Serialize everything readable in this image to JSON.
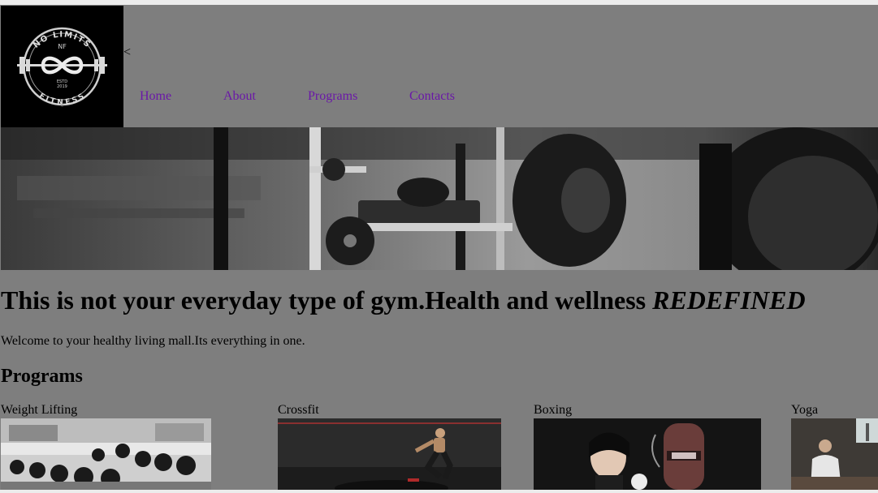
{
  "brand": {
    "logo_text_top": "NO LIMITS",
    "logo_text_bottom": "FITNESS",
    "logo_monogram": "NF",
    "logo_estd": "ESTD",
    "logo_year": "2019"
  },
  "header": {
    "broken_glyph": "<"
  },
  "nav": {
    "items": [
      {
        "label": "Home"
      },
      {
        "label": "About"
      },
      {
        "label": "Programs"
      },
      {
        "label": "Contacts"
      }
    ]
  },
  "hero": {
    "image_icon": "gym-equipment-photo"
  },
  "main": {
    "headline": "This is not your everyday type of gym.Health and wellness ",
    "headline_emphasis": "REDEFINED",
    "welcome": "Welcome to your healthy living mall.Its everything in one.",
    "programs_title": "Programs"
  },
  "programs": [
    {
      "label": "Weight Lifting",
      "image_icon": "dumbbell-rack-photo"
    },
    {
      "label": "Crossfit",
      "image_icon": "box-jump-photo"
    },
    {
      "label": "Boxing",
      "image_icon": "punching-bag-photo"
    },
    {
      "label": "Yoga",
      "image_icon": "yoga-class-photo"
    }
  ],
  "colors": {
    "page_background": "#7e7e7e",
    "link": "#6a17a8",
    "logo_background": "#000000"
  }
}
